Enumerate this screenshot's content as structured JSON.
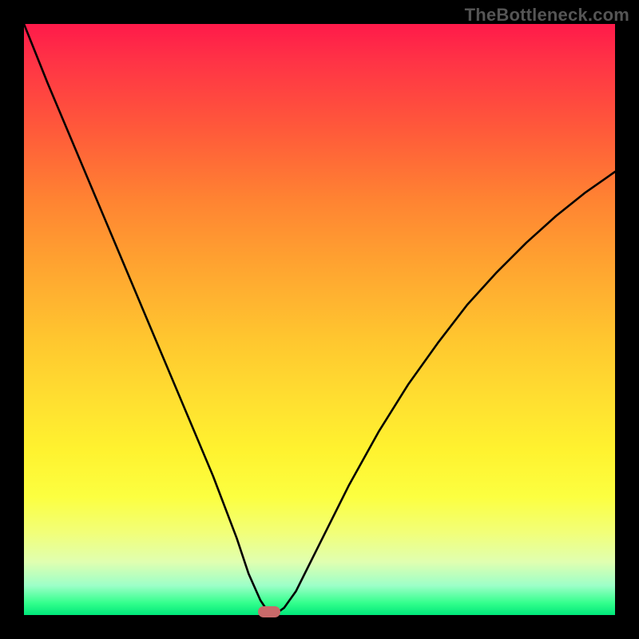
{
  "watermark": "TheBottleneck.com",
  "chart_data": {
    "type": "line",
    "title": "",
    "xlabel": "",
    "ylabel": "",
    "xlim": [
      0,
      100
    ],
    "ylim": [
      0,
      100
    ],
    "grid": false,
    "series": [
      {
        "name": "curve",
        "color": "#000000",
        "x": [
          0,
          4,
          8,
          12,
          16,
          20,
          24,
          28,
          32,
          36,
          38,
          40,
          41,
          42,
          43,
          44,
          46,
          50,
          55,
          60,
          65,
          70,
          75,
          80,
          85,
          90,
          95,
          100
        ],
        "y": [
          100,
          90,
          80.5,
          71,
          61.5,
          52,
          42.5,
          33,
          23.5,
          13,
          7,
          2.5,
          1,
          0.5,
          0.5,
          1.2,
          4,
          12,
          22,
          31,
          39,
          46,
          52.5,
          58,
          63,
          67.5,
          71.5,
          75
        ]
      }
    ],
    "marker": {
      "x": 41.5,
      "y": 0.5,
      "color": "#c96a6a"
    }
  }
}
